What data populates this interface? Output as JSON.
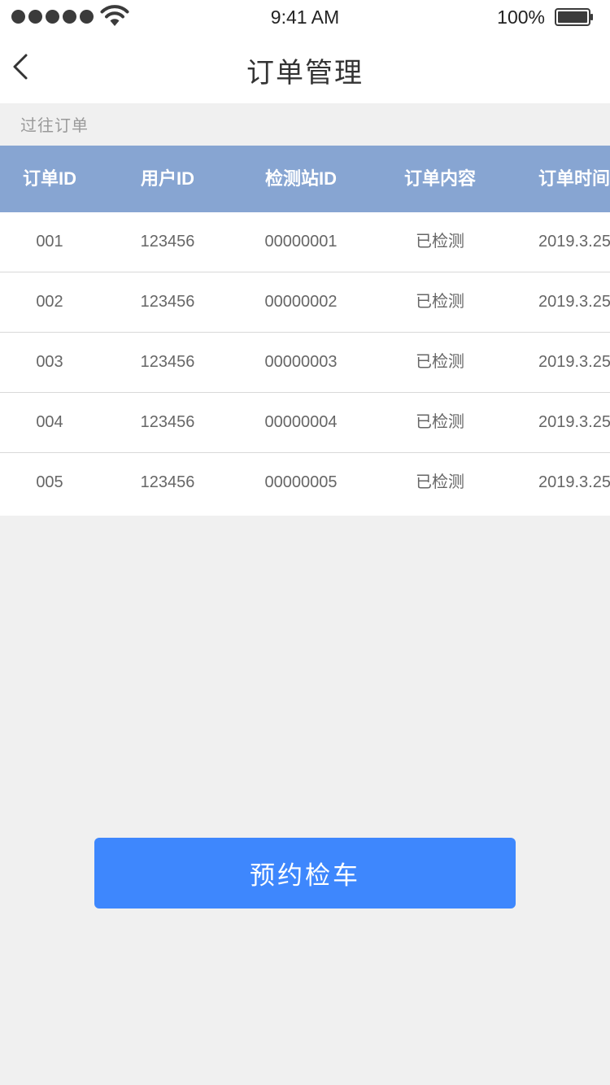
{
  "status_bar": {
    "time": "9:41 AM",
    "battery_percent": "100%",
    "signal_level": 5,
    "battery_level": 1.0
  },
  "nav": {
    "title": "订单管理",
    "back_icon": "chevron-left-icon"
  },
  "section": {
    "label": "过往订单"
  },
  "table": {
    "columns": [
      "订单ID",
      "用户ID",
      "检测站ID",
      "订单内容",
      "订单时间"
    ],
    "rows": [
      [
        "001",
        "123456",
        "00000001",
        "已检测",
        "2019.3.25"
      ],
      [
        "002",
        "123456",
        "00000002",
        "已检测",
        "2019.3.25"
      ],
      [
        "003",
        "123456",
        "00000003",
        "已检测",
        "2019.3.25"
      ],
      [
        "004",
        "123456",
        "00000004",
        "已检测",
        "2019.3.25"
      ],
      [
        "005",
        "123456",
        "00000005",
        "已检测",
        "2019.3.25"
      ]
    ]
  },
  "actions": {
    "book_label": "预约检车"
  },
  "colors": {
    "header_bg": "#87a5d2",
    "button_bg": "#3e87fd",
    "page_bg": "#f0f0f0"
  }
}
